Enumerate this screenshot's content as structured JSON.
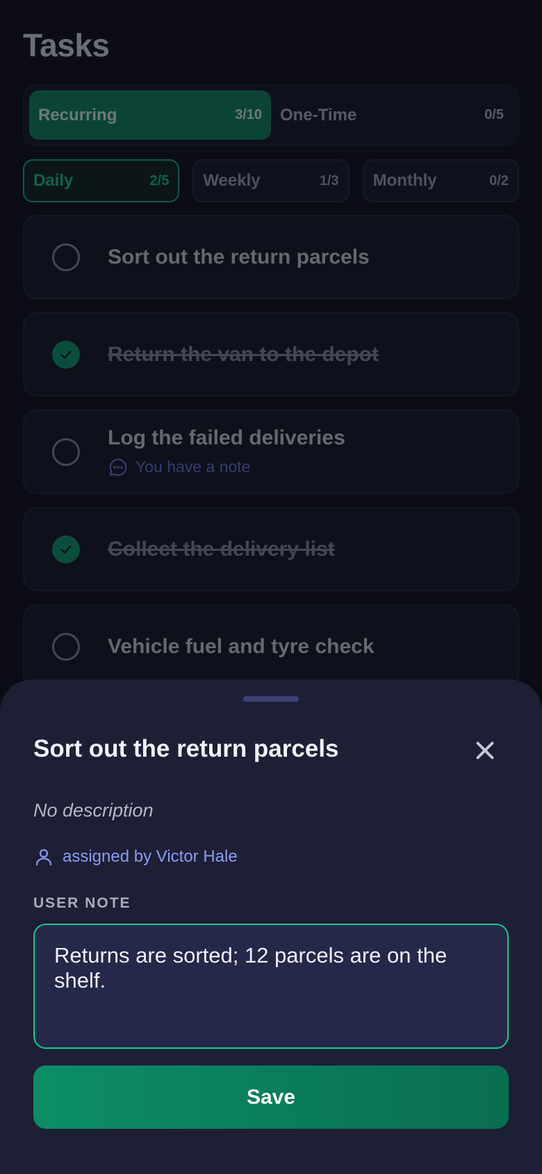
{
  "page": {
    "title": "Tasks"
  },
  "segments": [
    {
      "label": "Recurring",
      "count": "3/10",
      "active": true
    },
    {
      "label": "One-Time",
      "count": "0/5",
      "active": false
    }
  ],
  "frequency": [
    {
      "label": "Daily",
      "count": "2/5",
      "active": true
    },
    {
      "label": "Weekly",
      "count": "1/3",
      "active": false
    },
    {
      "label": "Monthly",
      "count": "0/2",
      "active": false
    }
  ],
  "tasks": [
    {
      "title": "Sort out the return parcels",
      "done": false,
      "note": ""
    },
    {
      "title": "Return the van to the depot",
      "done": true,
      "note": ""
    },
    {
      "title": "Log the failed deliveries",
      "done": false,
      "note": "You have a note"
    },
    {
      "title": "Collect the delivery list",
      "done": true,
      "note": ""
    },
    {
      "title": "Vehicle fuel and tyre check",
      "done": false,
      "note": ""
    }
  ],
  "sheet": {
    "title": "Sort out the return parcels",
    "description": "No description",
    "assigned": "assigned by Victor Hale",
    "note_label": "USER NOTE",
    "note_value": "Returns are sorted; 12 parcels are on the shelf.",
    "save_label": "Save"
  },
  "colors": {
    "accent": "#0e8a63",
    "accent_bright": "#17c98e",
    "note_link": "#6a78e0",
    "assigned_link": "#8c9af4"
  }
}
